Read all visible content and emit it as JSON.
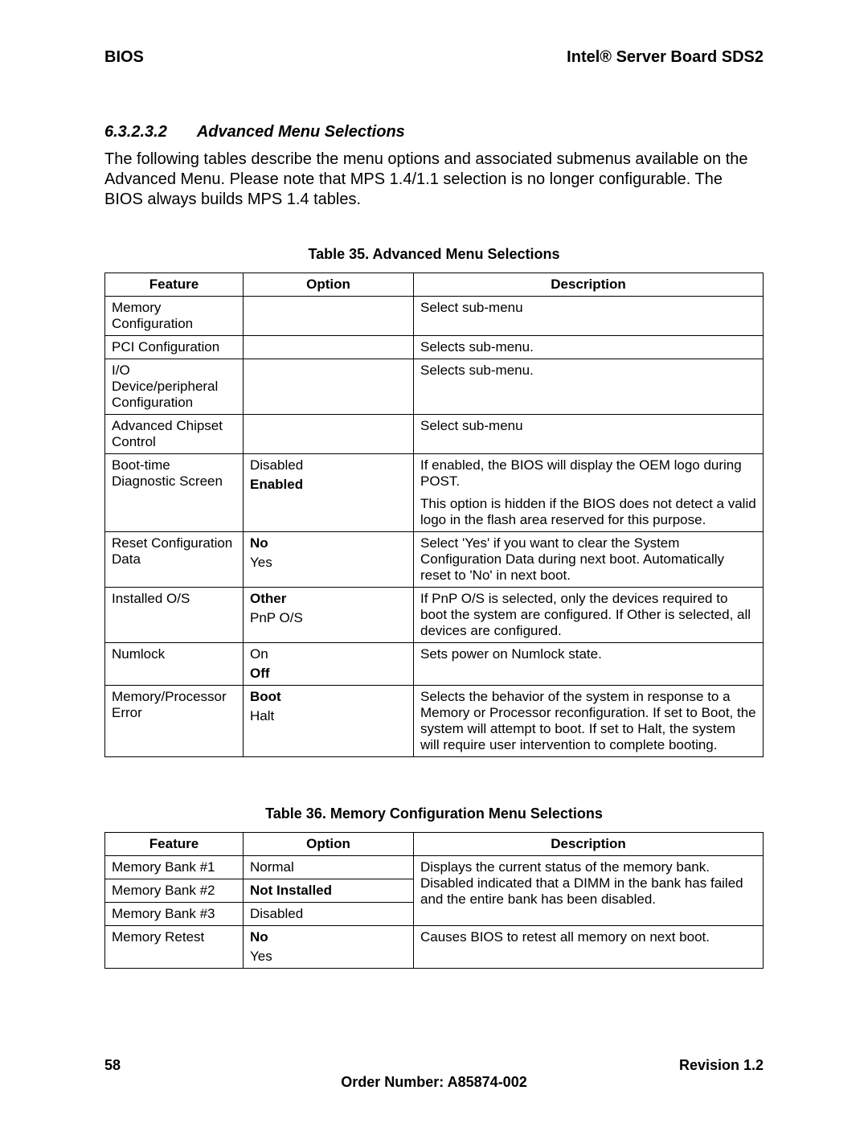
{
  "header": {
    "left": "BIOS",
    "right": "Intel® Server Board SDS2"
  },
  "section": {
    "number": "6.3.2.3.2",
    "title": "Advanced Menu Selections",
    "body": "The following tables describe the menu options and associated submenus available on the Advanced Menu. Please note that MPS 1.4/1.1 selection is no longer configurable. The BIOS always builds MPS 1.4 tables."
  },
  "table35": {
    "caption": "Table 35. Advanced Menu Selections",
    "headers": {
      "feature": "Feature",
      "option": "Option",
      "description": "Description"
    },
    "rows": [
      {
        "feature": "Memory Configuration",
        "options": [],
        "description": [
          "Select sub-menu"
        ]
      },
      {
        "feature": "PCI Configuration",
        "options": [],
        "description": [
          "Selects sub-menu."
        ]
      },
      {
        "feature": "I/O Device/peripheral Configuration",
        "options": [],
        "description": [
          "Selects sub-menu."
        ]
      },
      {
        "feature": "Advanced Chipset Control",
        "options": [],
        "description": [
          "Select sub-menu"
        ]
      },
      {
        "feature": "Boot-time Diagnostic Screen",
        "options": [
          {
            "text": "Disabled",
            "bold": false
          },
          {
            "text": "Enabled",
            "bold": true
          }
        ],
        "description": [
          "If enabled, the BIOS will display the OEM logo during POST.",
          "This option is hidden if the BIOS does not detect a valid logo in the flash area reserved for this purpose."
        ]
      },
      {
        "feature": "Reset Configuration Data",
        "options": [
          {
            "text": "No",
            "bold": true
          },
          {
            "text": "Yes",
            "bold": false
          }
        ],
        "description": [
          "Select 'Yes' if you want to clear the System Configuration Data during next boot. Automatically reset to 'No' in next boot."
        ]
      },
      {
        "feature": "Installed O/S",
        "options": [
          {
            "text": "Other",
            "bold": true
          },
          {
            "text": "PnP O/S",
            "bold": false
          }
        ],
        "description": [
          "If PnP O/S is selected, only the devices required to boot the system are configured. If Other is selected, all devices are configured."
        ]
      },
      {
        "feature": "Numlock",
        "options": [
          {
            "text": "On",
            "bold": false
          },
          {
            "text": "Off",
            "bold": true
          }
        ],
        "description": [
          "Sets power on Numlock state."
        ]
      },
      {
        "feature": "Memory/Processor Error",
        "options": [
          {
            "text": "Boot",
            "bold": true
          },
          {
            "text": "Halt",
            "bold": false
          }
        ],
        "description": [
          "Selects the behavior of the system in response to a Memory or Processor reconfiguration. If set to Boot, the system will attempt to boot. If set to Halt, the system will require user intervention to complete booting."
        ]
      }
    ]
  },
  "table36": {
    "caption": "Table 36. Memory Configuration Menu Selections",
    "headers": {
      "feature": "Feature",
      "option": "Option",
      "description": "Description"
    },
    "bank_rows": [
      {
        "feature": "Memory Bank #1",
        "options": [
          {
            "text": "Normal",
            "bold": false
          }
        ]
      },
      {
        "feature": "Memory Bank #2",
        "options": [
          {
            "text": "Not Installed",
            "bold": true
          }
        ]
      },
      {
        "feature": "Memory Bank #3",
        "options": [
          {
            "text": "Disabled",
            "bold": false
          }
        ]
      }
    ],
    "bank_description": "Displays the current status of the memory bank. Disabled indicated that a DIMM in the bank has failed and the entire bank has been disabled.",
    "retest_row": {
      "feature": "Memory Retest",
      "options": [
        {
          "text": "No",
          "bold": true
        },
        {
          "text": "Yes",
          "bold": false
        }
      ],
      "description": "Causes BIOS to retest all memory on next boot."
    }
  },
  "footer": {
    "page": "58",
    "revision": "Revision 1.2",
    "order": "Order Number:  A85874-002"
  }
}
